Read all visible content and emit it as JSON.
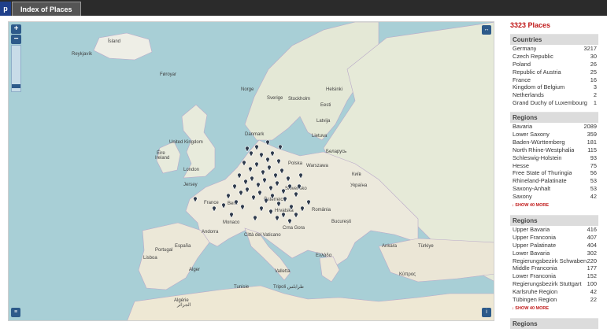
{
  "tabs": {
    "cut_tab": "p",
    "active_tab": "Index of Places"
  },
  "map": {
    "zoom_in": "+",
    "zoom_out": "−",
    "fullscreen": "↔",
    "layers": "≡",
    "info": "i",
    "labels": [
      {
        "t": "Ísland"
      },
      {
        "t": "Reykjavík"
      },
      {
        "t": "Føroyar"
      },
      {
        "t": "Norge"
      },
      {
        "t": "Sverige"
      },
      {
        "t": "Stockholm"
      },
      {
        "t": "Helsinki"
      },
      {
        "t": "Eesti"
      },
      {
        "t": "Latvija"
      },
      {
        "t": "Lietuva"
      },
      {
        "t": "Беларусь"
      },
      {
        "t": "Danmark"
      },
      {
        "t": "United Kingdom"
      },
      {
        "t": "Éire"
      },
      {
        "t": "Ireland"
      },
      {
        "t": "London"
      },
      {
        "t": "Polska"
      },
      {
        "t": "Warszawa"
      },
      {
        "t": "Київ"
      },
      {
        "t": "Україна"
      },
      {
        "t": "Jersey"
      },
      {
        "t": "France"
      },
      {
        "t": "Bern"
      },
      {
        "t": "Slovensko"
      },
      {
        "t": "Österreich"
      },
      {
        "t": "Hrvatska"
      },
      {
        "t": "România"
      },
      {
        "t": "Monaco"
      },
      {
        "t": "Città del Vaticano"
      },
      {
        "t": "Crna Gora"
      },
      {
        "t": "București"
      },
      {
        "t": "Andorra"
      },
      {
        "t": "España"
      },
      {
        "t": "Portugal"
      },
      {
        "t": "Lisboa"
      },
      {
        "t": "Ελλάδα"
      },
      {
        "t": "Türkiye"
      },
      {
        "t": "Ankara"
      },
      {
        "t": "Valletta"
      },
      {
        "t": "Tunisie"
      },
      {
        "t": "Tripoli طرابلس"
      },
      {
        "t": "Algérie"
      },
      {
        "t": "الجزائر"
      },
      {
        "t": "Alger"
      },
      {
        "t": "Κύπρος"
      }
    ]
  },
  "sidebar": {
    "places_count": "3323 Places",
    "countries": {
      "title": "Countries",
      "items": [
        {
          "name": "Germany",
          "count": "3217"
        },
        {
          "name": "Czech Republic",
          "count": "30"
        },
        {
          "name": "Poland",
          "count": "26"
        },
        {
          "name": "Republic of Austria",
          "count": "25"
        },
        {
          "name": "France",
          "count": "16"
        },
        {
          "name": "Kingdom of Belgium",
          "count": "3"
        },
        {
          "name": "Netherlands",
          "count": "2"
        },
        {
          "name": "Grand Duchy of Luxembourg",
          "count": "1"
        }
      ]
    },
    "regions1": {
      "title": "Regions",
      "items": [
        {
          "name": "Bavaria",
          "count": "2089"
        },
        {
          "name": "Lower Saxony",
          "count": "359"
        },
        {
          "name": "Baden-Württemberg",
          "count": "181"
        },
        {
          "name": "North Rhine-Westphalia",
          "count": "115"
        },
        {
          "name": "Schleswig-Holstein",
          "count": "93"
        },
        {
          "name": "Hesse",
          "count": "75"
        },
        {
          "name": "Free State of Thuringia",
          "count": "56"
        },
        {
          "name": "Rhineland-Palatinate",
          "count": "53"
        },
        {
          "name": "Saxony-Anhalt",
          "count": "53"
        },
        {
          "name": "Saxony",
          "count": "42"
        }
      ],
      "show_more": "↓ SHOW 40 MORE"
    },
    "regions2": {
      "title": "Regions",
      "items": [
        {
          "name": "Upper Bavaria",
          "count": "416"
        },
        {
          "name": "Upper Franconia",
          "count": "407"
        },
        {
          "name": "Upper Palatinate",
          "count": "404"
        },
        {
          "name": "Lower Bavaria",
          "count": "302"
        },
        {
          "name": "Regierungsbezirk Schwaben",
          "count": "220"
        },
        {
          "name": "Middle Franconia",
          "count": "177"
        },
        {
          "name": "Lower Franconia",
          "count": "152"
        },
        {
          "name": "Regierungsbezirk Stuttgart",
          "count": "100"
        },
        {
          "name": "Karlsruhe Region",
          "count": "42"
        },
        {
          "name": "Tübingen Region",
          "count": "22"
        }
      ],
      "show_more": "↓ SHOW 40 MORE"
    },
    "regions3": {
      "title": "Regions"
    }
  }
}
